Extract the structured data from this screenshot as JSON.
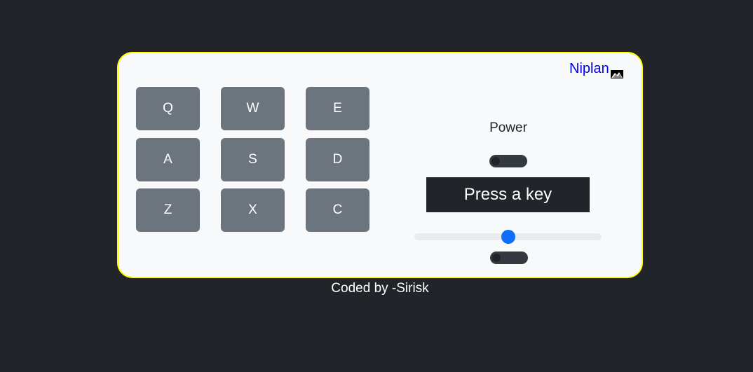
{
  "brand": {
    "name": "Niplan",
    "logo_icon": "mountain-logo-icon"
  },
  "pads": {
    "q": "Q",
    "w": "W",
    "e": "E",
    "a": "A",
    "s": "S",
    "d": "D",
    "z": "Z",
    "x": "X",
    "c": "C"
  },
  "controls": {
    "power_label": "Power",
    "power_on": false,
    "display_text": "Press a key",
    "volume": 0.5,
    "bank_on": false
  },
  "footer": {
    "credit": "Coded by -Sirisk"
  },
  "colors": {
    "background": "#212529",
    "panel": "#f8f9fa",
    "panel_border": "#ffff00",
    "pad": "#6c757d",
    "display": "#212529",
    "accent": "#0d6efd",
    "brand_link": "#0000ee"
  }
}
